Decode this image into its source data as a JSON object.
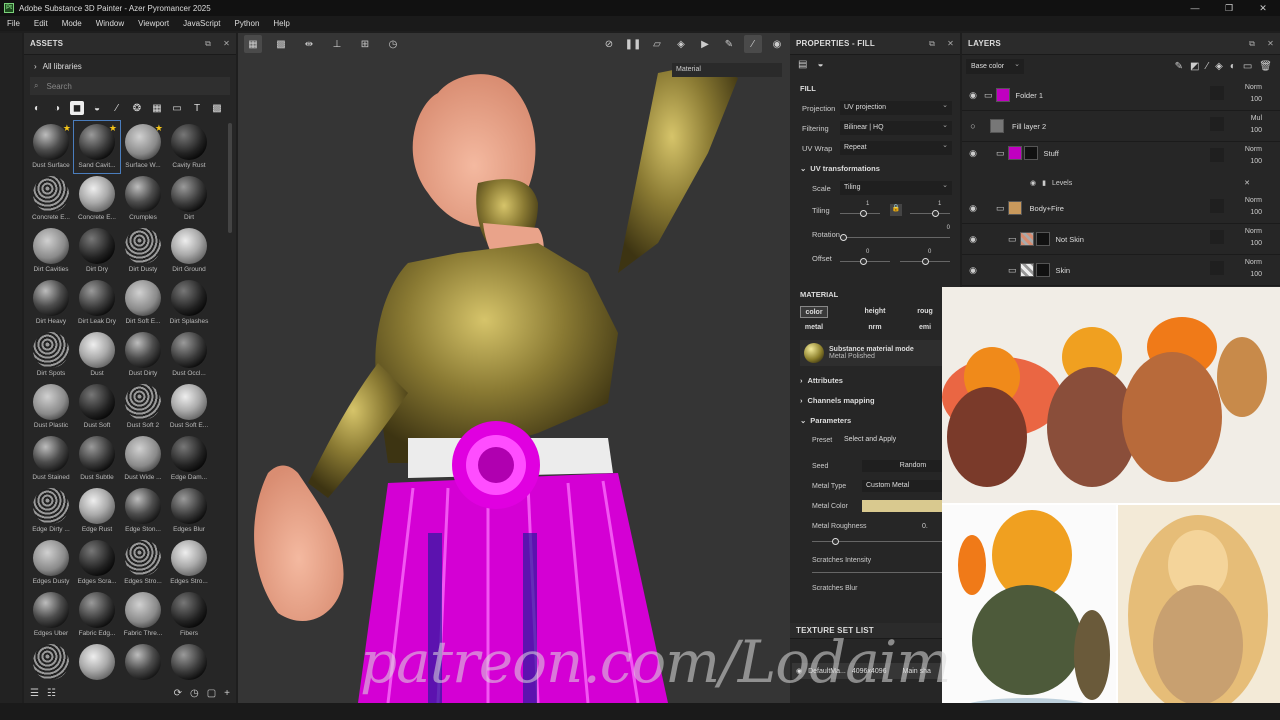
{
  "window": {
    "title": "Adobe Substance 3D Painter - Azer Pyromancer 2025",
    "app_badge": "Pt"
  },
  "menu": [
    "File",
    "Edit",
    "Mode",
    "Window",
    "Viewport",
    "JavaScript",
    "Python",
    "Help"
  ],
  "assets": {
    "title": "ASSETS",
    "library": "All libraries",
    "search_placeholder": "Search",
    "items": [
      {
        "label": "Dust Surface",
        "star": true
      },
      {
        "label": "Sand Cavit...",
        "star": true,
        "selected": true
      },
      {
        "label": "Surface W...",
        "star": true
      },
      {
        "label": "Cavity Rust"
      },
      {
        "label": "Concrete E..."
      },
      {
        "label": "Concrete E..."
      },
      {
        "label": "Crumples"
      },
      {
        "label": "Dirt"
      },
      {
        "label": "Dirt Cavities"
      },
      {
        "label": "Dirt Dry"
      },
      {
        "label": "Dirt Dusty"
      },
      {
        "label": "Dirt Ground"
      },
      {
        "label": "Dirt Heavy"
      },
      {
        "label": "Dirt Leak Dry"
      },
      {
        "label": "Dirt Soft E..."
      },
      {
        "label": "Dirt Splashes"
      },
      {
        "label": "Dirt Spots"
      },
      {
        "label": "Dust"
      },
      {
        "label": "Dust Dirty"
      },
      {
        "label": "Dust Occl..."
      },
      {
        "label": "Dust Plastic"
      },
      {
        "label": "Dust Soft"
      },
      {
        "label": "Dust Soft 2"
      },
      {
        "label": "Dust Soft E..."
      },
      {
        "label": "Dust Stained"
      },
      {
        "label": "Dust Subtle"
      },
      {
        "label": "Dust Wide ..."
      },
      {
        "label": "Edge Dam..."
      },
      {
        "label": "Edge Dirty ..."
      },
      {
        "label": "Edge Rust"
      },
      {
        "label": "Edge Ston..."
      },
      {
        "label": "Edges Blur"
      },
      {
        "label": "Edges Dusty"
      },
      {
        "label": "Edges Scra..."
      },
      {
        "label": "Edges Stro..."
      },
      {
        "label": "Edges Stro..."
      },
      {
        "label": "Edges Uber"
      },
      {
        "label": "Fabric Edg..."
      },
      {
        "label": "Fabric Thre..."
      },
      {
        "label": "Fibers"
      },
      {
        "label": ""
      },
      {
        "label": ""
      },
      {
        "label": ""
      },
      {
        "label": ""
      }
    ]
  },
  "viewport": {
    "material_select": "Material"
  },
  "properties": {
    "title": "PROPERTIES - FILL",
    "fill_label": "FILL",
    "projection": {
      "label": "Projection",
      "value": "UV projection"
    },
    "filtering": {
      "label": "Filtering",
      "value": "Bilinear | HQ"
    },
    "uvwrap": {
      "label": "UV Wrap",
      "value": "Repeat"
    },
    "uv_transform": "UV transformations",
    "scale": {
      "label": "Scale",
      "value": "Tiling"
    },
    "tiling": {
      "label": "Tiling",
      "v1": "1",
      "v2": "1"
    },
    "rotation": {
      "label": "Rotation",
      "value": "0"
    },
    "offset": {
      "label": "Offset",
      "v1": "0",
      "v2": "0"
    },
    "material_label": "MATERIAL",
    "channels": [
      "color",
      "height",
      "roug",
      "metal",
      "nrm",
      "emi"
    ],
    "mode_title": "Substance material mode",
    "mode_value": "Metal Polished",
    "attributes": "Attributes",
    "channels_mapping": "Channels mapping",
    "parameters": "Parameters",
    "preset": {
      "label": "Preset",
      "value": "Select and Apply"
    },
    "seed": {
      "label": "Seed",
      "value": "Random"
    },
    "metal_type": {
      "label": "Metal Type",
      "value": "Custom Metal"
    },
    "metal_color": {
      "label": "Metal Color",
      "color": "#d9c98f"
    },
    "metal_roughness": {
      "label": "Metal Roughness",
      "value": "0."
    },
    "scratches_intensity": "Scratches Intensity",
    "scratches_blur": "Scratches Blur"
  },
  "texture_set": {
    "title": "TEXTURE SET LIST",
    "name": "DefaultMa...",
    "size": "4096x4096",
    "shader": "Main sha"
  },
  "layers": {
    "title": "LAYERS",
    "blend_select": "Base color",
    "rows": [
      {
        "name": "Folder 1",
        "mode": "Norm",
        "opacity": "100"
      },
      {
        "name": "Fill layer 2",
        "mode": "Mul",
        "opacity": "100"
      },
      {
        "name": "Stuff",
        "mode": "Norm",
        "opacity": "100"
      },
      {
        "name": "Body+Fire",
        "mode": "Norm",
        "opacity": "100"
      },
      {
        "name": "Not Skin",
        "mode": "Norm",
        "opacity": "100"
      },
      {
        "name": "Skin",
        "mode": "Norm",
        "opacity": "100"
      }
    ],
    "sub_levels": "Levels"
  },
  "watermark": "patreon.com/Lodaim"
}
